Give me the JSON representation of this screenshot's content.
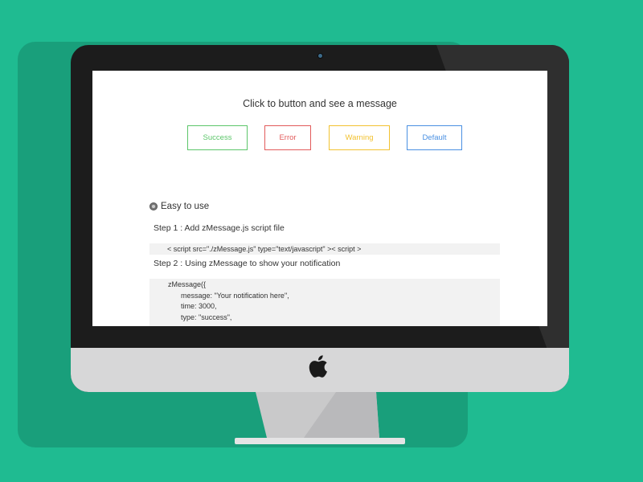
{
  "page": {
    "headline": "Click to button and see a message"
  },
  "buttons": {
    "success": {
      "label": "Success",
      "color": "#5cc66a"
    },
    "error": {
      "label": "Error",
      "color": "#e25b5b"
    },
    "warning": {
      "label": "Warning",
      "color": "#f2c230"
    },
    "default": {
      "label": "Default",
      "color": "#4a90e2"
    }
  },
  "section": {
    "title": "Easy to use",
    "icon": "circle-bullet-icon"
  },
  "step1": {
    "label": "Step 1 : Add zMessage.js script file",
    "code": "< script src=\"./zMessage.js\" type=\"text/javascript\" >< script >"
  },
  "step2": {
    "label": "Step 2 : Using zMessage to show your notification",
    "code_lines": [
      "zMessage({",
      "message: \"Your notification here\",",
      "time: 3000,",
      "type: \"success\","
    ]
  },
  "colors": {
    "background": "#1fbb91",
    "bezel": "#1c1c1c",
    "chin": "#d7d7d8"
  },
  "icons": {
    "camera": "camera-icon",
    "logo": "apple-logo-icon"
  }
}
